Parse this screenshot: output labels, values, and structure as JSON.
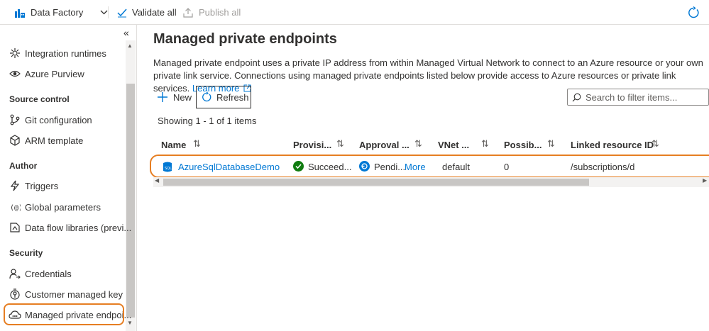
{
  "topbar": {
    "app_name": "Data Factory",
    "validate_all": "Validate all",
    "publish_all": "Publish all"
  },
  "sidebar": {
    "items_top": [
      {
        "label": "Integration runtimes",
        "icon": "integration-runtime-icon"
      },
      {
        "label": "Azure Purview",
        "icon": "eye-icon"
      }
    ],
    "section_source_control": "Source control",
    "items_source_control": [
      {
        "label": "Git configuration",
        "icon": "git-icon"
      },
      {
        "label": "ARM template",
        "icon": "cube-icon"
      }
    ],
    "section_author": "Author",
    "items_author": [
      {
        "label": "Triggers",
        "icon": "lightning-icon"
      },
      {
        "label": "Global parameters",
        "icon": "parameters-icon"
      },
      {
        "label": "Data flow libraries (previ...",
        "icon": "library-icon"
      }
    ],
    "section_security": "Security",
    "items_security": [
      {
        "label": "Credentials",
        "icon": "credentials-icon"
      },
      {
        "label": "Customer managed key",
        "icon": "key-icon"
      },
      {
        "label": "Managed private endpoi...",
        "icon": "cloud-icon"
      }
    ]
  },
  "main": {
    "title": "Managed private endpoints",
    "description": "Managed private endpoint uses a private IP address from within Managed Virtual Network to connect to an Azure resource or your own private link service. Connections using managed private endpoints listed below provide access to Azure resources or private link services.",
    "learn_more": "Learn more",
    "new_label": "New",
    "refresh_label": "Refresh",
    "search_placeholder": "Search to filter items...",
    "showing": "Showing 1 - 1 of 1 items",
    "columns": [
      "Name",
      "Provisi...",
      "Approval ...",
      "VNet ...",
      "Possib...",
      "Linked resource ID"
    ],
    "rows": [
      {
        "name": "AzureSqlDatabaseDemo",
        "provisioning": "Succeed...",
        "approval": "Pendi...",
        "approval_more": "More",
        "vnet": "default",
        "possible": "0",
        "linked_resource_id": "/subscriptions/d"
      }
    ]
  },
  "colors": {
    "accent": "#0078d4",
    "highlight": "#e67e22",
    "success": "#107c10"
  }
}
